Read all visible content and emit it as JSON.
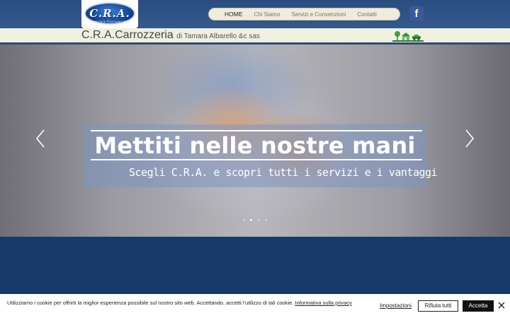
{
  "header": {
    "logo_text": "C.R.A.",
    "logo_subtext": "Carrozzeria Riparazioni Auto",
    "nav": [
      {
        "label": "HOME",
        "active": true
      },
      {
        "label": "Chi Siamo",
        "active": false
      },
      {
        "label": "Servizi e Convenzioni",
        "active": false
      },
      {
        "label": "Contatti",
        "active": false
      }
    ],
    "social_icon": "facebook-icon"
  },
  "titlebar": {
    "brand": "C.R.A.Carrozzeria",
    "brand_sub": "di Tamara Albarello &c sas",
    "badge_icon": "eco-garage-icon"
  },
  "hero": {
    "headline": "Mettiti nelle nostre mani",
    "subline": "Scegli C.R.A. e scopri tutti i servizi e i vantaggi",
    "prev_icon": "chevron-left-icon",
    "next_icon": "chevron-right-icon",
    "slide_count": 4,
    "active_slide": 2
  },
  "cookie": {
    "text": "Utilizziamo i cookie per offrirti la miglior esperienza possibile sul nostro sito web. Accettando, accetti l'utilizzo di tali cookie. ",
    "link": "Informativa sulla privacy",
    "settings": "Impostazioni",
    "reject": "Rifiuta tutti",
    "accept": "Accetta",
    "close_icon": "close-icon"
  },
  "colors": {
    "header_bg": "#2a4d80",
    "nav_bg": "#f0ecdb",
    "titlebar_bg": "#f0f0e1",
    "page_bg": "#173a6a",
    "facebook": "#3b5998"
  }
}
